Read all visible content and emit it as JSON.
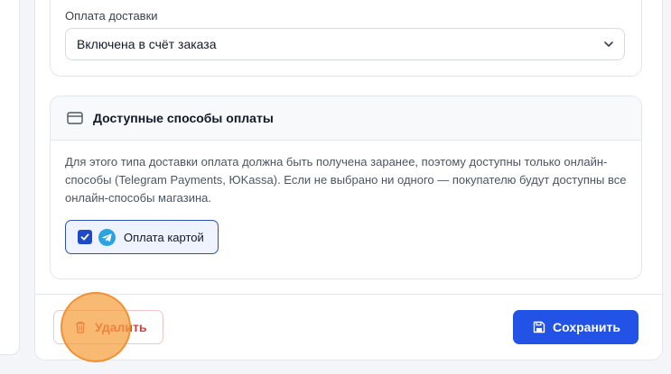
{
  "delivery": {
    "payment_label": "Оплата доставки",
    "payment_value": "Включена в счёт заказа"
  },
  "payment_methods": {
    "title": "Доступные способы оплаты",
    "description": "Для этого типа доставки оплата должна быть получена заранее, поэтому доступны только онлайн-способы (Telegram Payments, ЮKassa). Если не выбрано ни одного — покупателю будут доступны все онлайн-способы магазина.",
    "options": [
      {
        "label": "Оплата картой",
        "checked": true,
        "icon": "telegram-icon"
      }
    ]
  },
  "footer": {
    "delete_label": "Удалить",
    "save_label": "Сохранить"
  },
  "colors": {
    "primary": "#2352e6",
    "danger": "#dc3b3b",
    "click_marker": "#f59e3c"
  }
}
